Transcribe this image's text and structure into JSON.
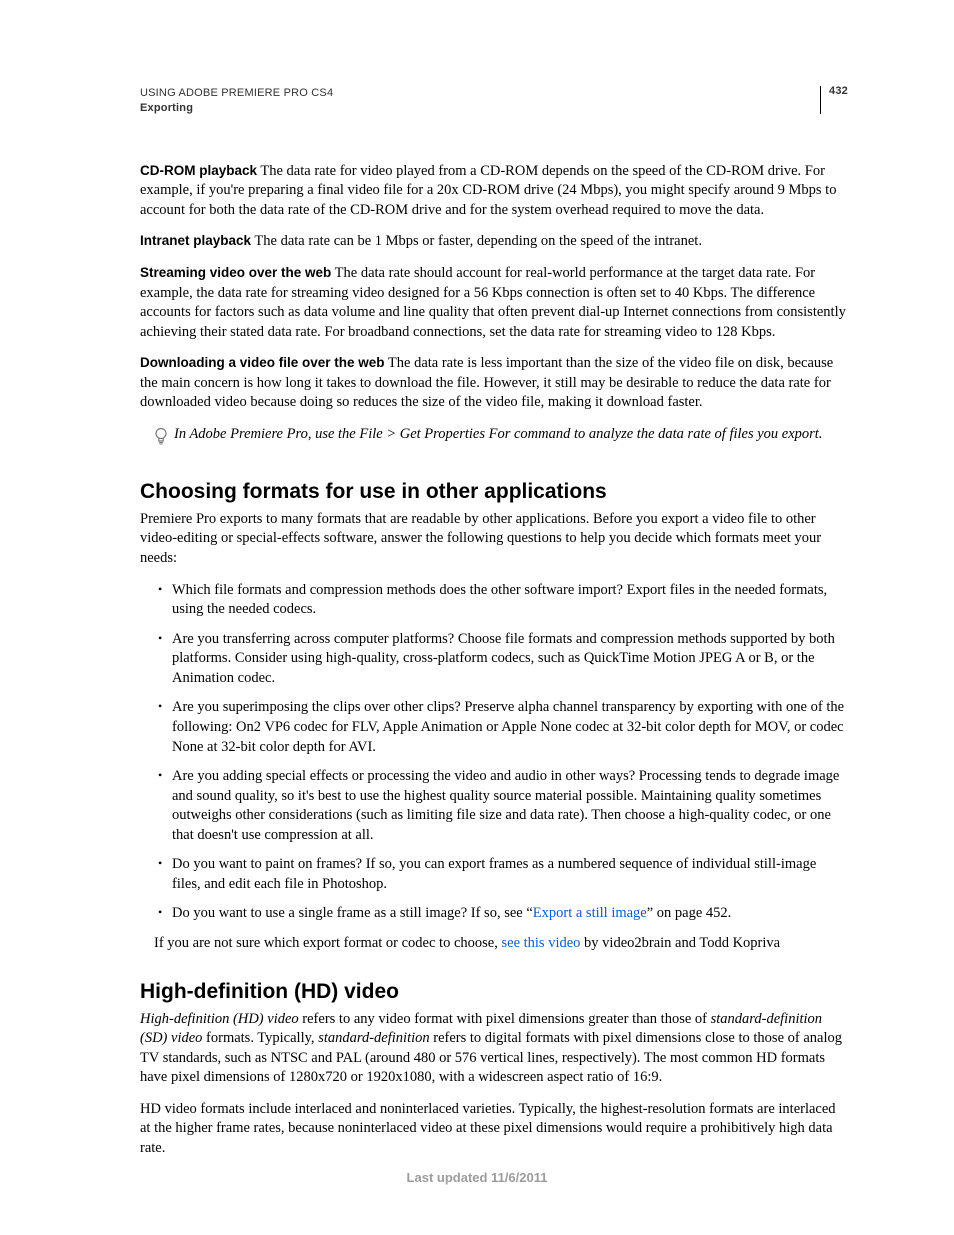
{
  "header": {
    "doc_title": "USING ADOBE PREMIERE PRO CS4",
    "section": "Exporting",
    "page_number": "432"
  },
  "definitions": [
    {
      "term": "CD-ROM playback",
      "body": "  The data rate for video played from a CD-ROM depends on the speed of the CD-ROM drive. For example, if you're preparing a final video file for a 20x CD-ROM drive (24 Mbps), you might specify around 9 Mbps to account for both the data rate of the CD-ROM drive and for the system overhead required to move the data."
    },
    {
      "term": "Intranet playback",
      "body": "  The data rate can be 1 Mbps or faster, depending on the speed of the intranet."
    },
    {
      "term": "Streaming video over the web",
      "body": "  The data rate should account for real-world performance at the target data rate. For example, the data rate for streaming video designed for a 56 Kbps connection is often set to 40 Kbps. The difference accounts for factors such as data volume and line quality that often prevent dial-up Internet connections from consistently achieving their stated data rate. For broadband connections, set the data rate for streaming video to 128 Kbps."
    },
    {
      "term": "Downloading a video file over the web",
      "body": "  The data rate is less important than the size of the video file on disk, because the main concern is how long it takes to download the file. However, it still may be desirable to reduce the data rate for downloaded video because doing so reduces the size of the video file, making it download faster."
    }
  ],
  "tip": "In Adobe Premiere Pro, use the File > Get Properties For command to analyze the data rate of files you export.",
  "section1": {
    "heading": "Choosing formats for use in other applications",
    "intro": "Premiere Pro exports to many formats that are readable by other applications. Before you export a video file to other video-editing or special-effects software, answer the following questions to help you decide which formats meet your needs:",
    "bullets": [
      "Which file formats and compression methods does the other software import? Export files in the needed formats, using the needed codecs.",
      "Are you transferring across computer platforms? Choose file formats and compression methods supported by both platforms. Consider using high-quality, cross-platform codecs, such as QuickTime Motion JPEG A or B, or the Animation codec.",
      "Are you superimposing the clips over other clips? Preserve alpha channel transparency by exporting with one of the following: On2 VP6 codec for FLV, Apple Animation or Apple None codec at 32-bit color depth for MOV, or codec None at 32-bit color depth for AVI.",
      "Are you adding special effects or processing the video and audio in other ways? Processing tends to degrade image and sound quality, so it's best to use the highest quality source material possible. Maintaining quality sometimes outweighs other considerations (such as limiting file size and data rate). Then choose a high-quality codec, or one that doesn't use compression at all.",
      "Do you want to paint on frames? If so, you can export frames as a numbered sequence of individual still-image files, and edit each file in Photoshop."
    ],
    "bullet_last_pre": "Do you want to use a single frame as a still image? If so, see “",
    "bullet_last_link": "Export a still image",
    "bullet_last_post": "” on page 452.",
    "closing_pre": "If you are not sure which export format or codec to choose, ",
    "closing_link": "see this video",
    "closing_post": " by video2brain and Todd Kopriva"
  },
  "section2": {
    "heading": "High-definition (HD) video",
    "p1_a": "High-definition (HD) video",
    "p1_b": " refers to any video format with pixel dimensions greater than those of ",
    "p1_c": "standard-definition (SD) video",
    "p1_d": " formats. Typically, ",
    "p1_e": "standard-definition",
    "p1_f": " refers to digital formats with pixel dimensions close to those of analog TV standards, such as NTSC and PAL (around 480 or 576 vertical lines, respectively). The most common HD formats have pixel dimensions of 1280x720 or 1920x1080, with a widescreen aspect ratio of 16:9.",
    "p2": "HD video formats include interlaced and noninterlaced varieties. Typically, the highest-resolution formats are interlaced at the higher frame rates, because noninterlaced video at these pixel dimensions would require a prohibitively high data rate."
  },
  "footer": "Last updated 11/6/2011"
}
